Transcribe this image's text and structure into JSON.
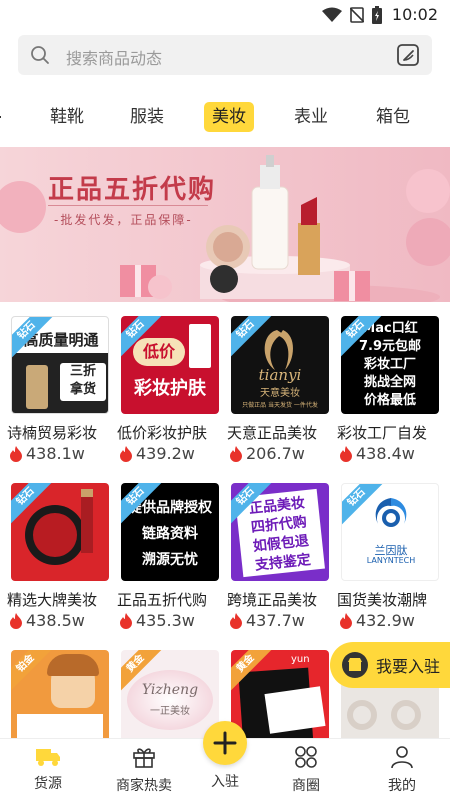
{
  "status_bar": {
    "time": "10:02"
  },
  "search": {
    "placeholder": "搜索商品动态"
  },
  "tabs": [
    {
      "label": "鞋靴",
      "active": false
    },
    {
      "label": "服装",
      "active": false
    },
    {
      "label": "美妆",
      "active": true
    },
    {
      "label": "表业",
      "active": false
    },
    {
      "label": "箱包",
      "active": false
    }
  ],
  "banner": {
    "title": "正品五折代购",
    "subtitle": "-批发代发，正品保障-"
  },
  "shops": [
    {
      "name": "诗楠贸易彩妆",
      "hot": "438.1w",
      "tag": "钻石",
      "thumb_text": [
        "高质量明通",
        "三折",
        "拿货"
      ]
    },
    {
      "name": "低价彩妆护肤",
      "hot": "439.2w",
      "tag": "钻石",
      "thumb_text": [
        "低价",
        "彩妆护肤"
      ]
    },
    {
      "name": "天意正品美妆",
      "hot": "206.7w",
      "tag": "钻石",
      "thumb_text": [
        "tianyi",
        "天意美妆",
        "只做正品  当天发货  一件代发"
      ]
    },
    {
      "name": "彩妆工厂自发",
      "hot": "438.4w",
      "tag": "钻石",
      "thumb_text": [
        "Mac口红",
        "7.9元包邮",
        "彩妆工厂",
        "挑战全网",
        "价格最低"
      ]
    },
    {
      "name": "精选大牌美妆",
      "hot": "438.5w",
      "tag": "钻石",
      "thumb_text": []
    },
    {
      "name": "正品五折代购",
      "hot": "435.3w",
      "tag": "钻石",
      "thumb_text": [
        "提供品牌授权",
        "链路资料",
        "溯源无忧"
      ]
    },
    {
      "name": "跨境正品美妆",
      "hot": "437.7w",
      "tag": "钻石",
      "thumb_text": [
        "正品美妆",
        "四折代购",
        "如假包退",
        "支持鉴定"
      ]
    },
    {
      "name": "国货美妆潮牌",
      "hot": "432.9w",
      "tag": "钻石",
      "thumb_text": [
        "兰因肽",
        "LANYNTECH"
      ]
    },
    {
      "name": "",
      "hot": "",
      "tag": "铂金",
      "thumb_text": []
    },
    {
      "name": "",
      "hot": "",
      "tag": "黄金",
      "thumb_text": [
        "Yizheng",
        "一正美妆"
      ]
    },
    {
      "name": "",
      "hot": "",
      "tag": "黄金",
      "thumb_text": [
        "yun"
      ]
    },
    {
      "name": "",
      "hot": "",
      "tag": "",
      "thumb_text": []
    }
  ],
  "join_float": {
    "label": "我要入驻"
  },
  "bottom_nav": [
    {
      "label": "货源",
      "icon": "truck-icon"
    },
    {
      "label": "商家热卖",
      "icon": "gift-icon"
    },
    {
      "label": "入驻",
      "icon": "plus-icon"
    },
    {
      "label": "商圈",
      "icon": "grid-circles-icon"
    },
    {
      "label": "我的",
      "icon": "person-icon"
    }
  ],
  "colors": {
    "accent": "#ffd83b",
    "hot": "#e8322a",
    "tag_blue": "#4fb3ea"
  }
}
